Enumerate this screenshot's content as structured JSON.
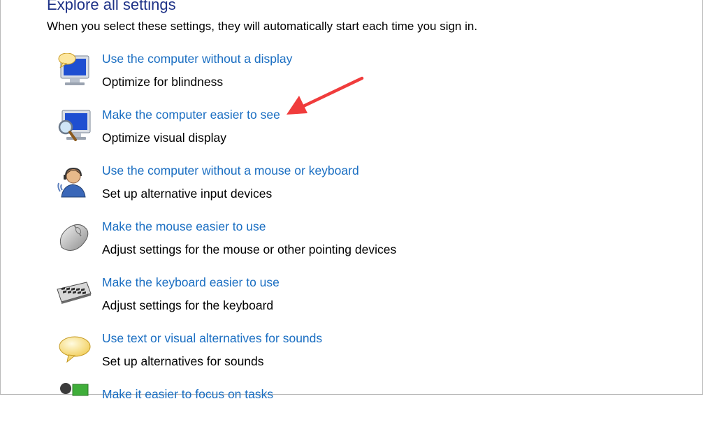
{
  "section": {
    "heading": "Explore all settings",
    "intro": "When you select these settings, they will automatically start each time you sign in."
  },
  "items": [
    {
      "link": "Use the computer without a display",
      "description": "Optimize for blindness",
      "icon": "monitor-speech-icon"
    },
    {
      "link": "Make the computer easier to see",
      "description": "Optimize visual display",
      "icon": "monitor-magnifier-icon"
    },
    {
      "link": "Use the computer without a mouse or keyboard",
      "description": "Set up alternative input devices",
      "icon": "person-headset-icon"
    },
    {
      "link": "Make the mouse easier to use",
      "description": "Adjust settings for the mouse or other pointing devices",
      "icon": "mouse-icon"
    },
    {
      "link": "Make the keyboard easier to use",
      "description": "Adjust settings for the keyboard",
      "icon": "keyboard-icon"
    },
    {
      "link": "Use text or visual alternatives for sounds",
      "description": "Set up alternatives for sounds",
      "icon": "speech-bubble-icon"
    },
    {
      "link": "Make it easier to focus on tasks",
      "description": "",
      "icon": "person-focus-icon"
    }
  ],
  "colors": {
    "heading": "#1e3287",
    "link": "#1a6ec2",
    "annotation_arrow": "#f03c3c"
  }
}
